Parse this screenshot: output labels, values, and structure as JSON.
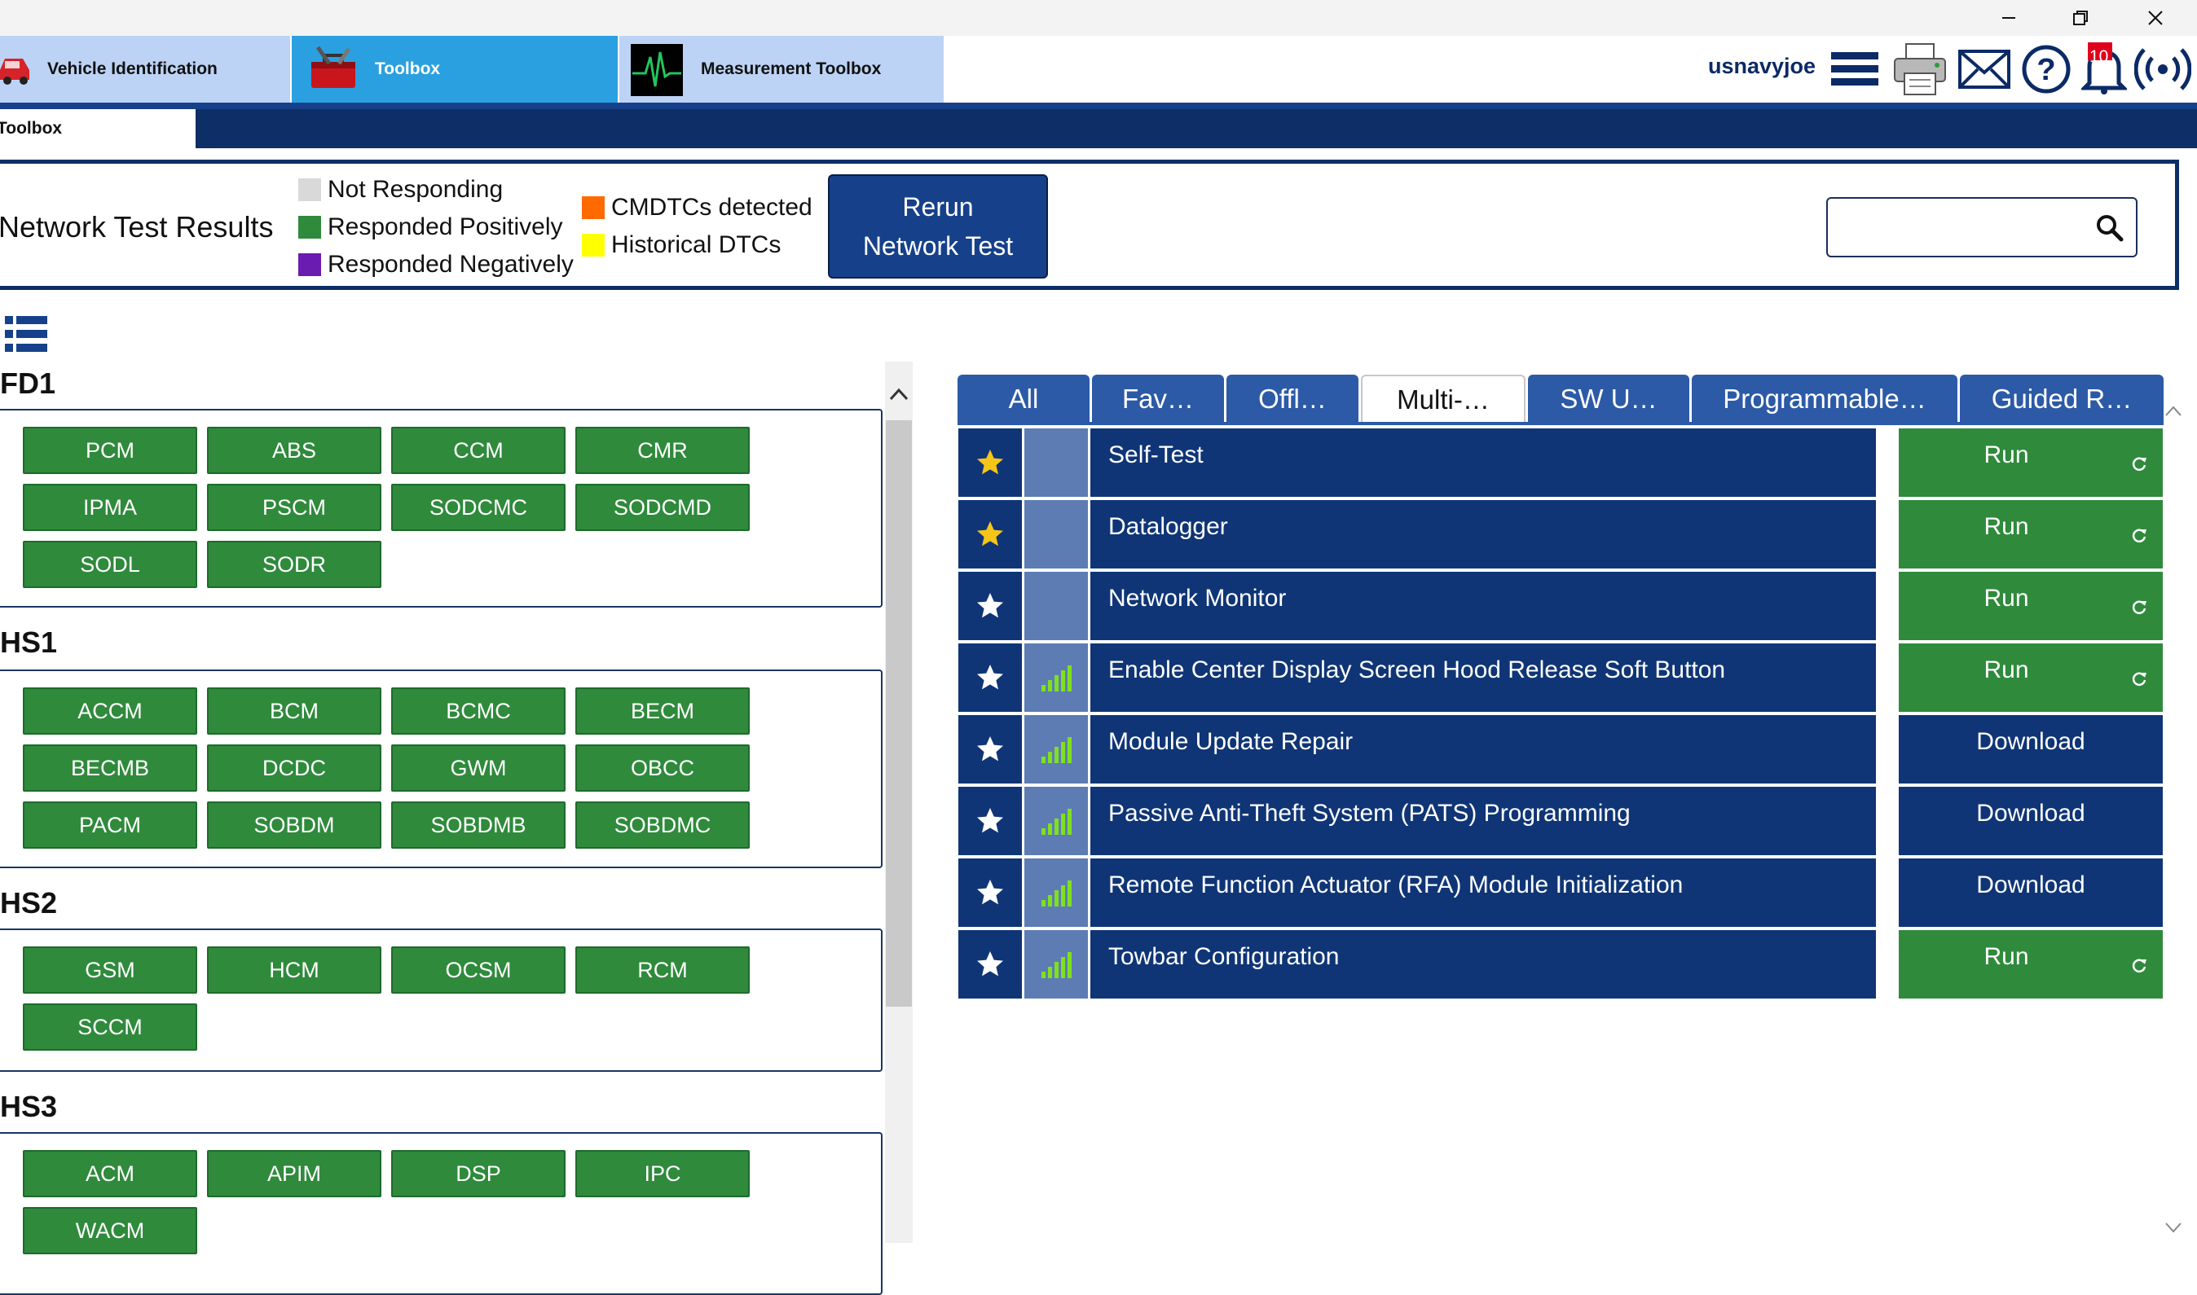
{
  "window": {
    "minimize": "—",
    "maximize": "❐",
    "close": "✕"
  },
  "app_tabs": [
    {
      "label": "Vehicle Identification",
      "icon": "car-icon"
    },
    {
      "label": "Toolbox",
      "icon": "toolbox-icon"
    },
    {
      "label": "Measurement Toolbox",
      "icon": "oscilloscope-icon"
    }
  ],
  "header": {
    "username": "usnavyjoe",
    "notification_count": "10",
    "icons": [
      "hamburger-menu-icon",
      "printer-icon",
      "mail-icon",
      "help-icon",
      "bell-icon",
      "wireless-icon"
    ]
  },
  "subnav": {
    "active_tab": "Toolbox"
  },
  "network_test": {
    "title": "Network Test Results",
    "legend": [
      {
        "label": "Not Responding",
        "color": "#d9d9d9"
      },
      {
        "label": "Responded Positively",
        "color": "#2f8a3c"
      },
      {
        "label": "Responded Negatively",
        "color": "#6a1bb0"
      },
      {
        "label": "CMDTCs detected",
        "color": "#ff6a00"
      },
      {
        "label": "Historical DTCs",
        "color": "#ffff00"
      }
    ],
    "rerun_line1": "Rerun",
    "rerun_line2": "Network Test",
    "search_value": ""
  },
  "networks": [
    {
      "name": "FD1",
      "modules": [
        "PCM",
        "ABS",
        "CCM",
        "CMR",
        "IPMA",
        "PSCM",
        "SODCMC",
        "SODCMD",
        "SODL",
        "SODR"
      ]
    },
    {
      "name": "HS1",
      "modules": [
        "ACCM",
        "BCM",
        "BCMC",
        "BECM",
        "BECMB",
        "DCDC",
        "GWM",
        "OBCC",
        "PACM",
        "SOBDM",
        "SOBDMB",
        "SOBDMC"
      ]
    },
    {
      "name": "HS2",
      "modules": [
        "GSM",
        "HCM",
        "OCSM",
        "RCM",
        "SCCM"
      ]
    },
    {
      "name": "HS3",
      "modules": [
        "ACM",
        "APIM",
        "DSP",
        "IPC",
        "WACM"
      ]
    }
  ],
  "filter_tabs": [
    {
      "label": "All",
      "active": false
    },
    {
      "label": "Fav…",
      "active": false
    },
    {
      "label": "Offl…",
      "active": false
    },
    {
      "label": "Multi-…",
      "active": true
    },
    {
      "label": "SW U…",
      "active": false
    },
    {
      "label": "Programmable…",
      "active": false
    },
    {
      "label": "Guided R…",
      "active": false
    }
  ],
  "tools": [
    {
      "name": "Self-Test",
      "favorite": true,
      "signal": false,
      "action": "Run",
      "type": "run"
    },
    {
      "name": "Datalogger",
      "favorite": true,
      "signal": false,
      "action": "Run",
      "type": "run"
    },
    {
      "name": "Network Monitor",
      "favorite": false,
      "signal": false,
      "action": "Run",
      "type": "run"
    },
    {
      "name": "Enable Center Display Screen Hood Release Soft Button",
      "favorite": false,
      "signal": true,
      "action": "Run",
      "type": "run"
    },
    {
      "name": "Module Update Repair",
      "favorite": false,
      "signal": true,
      "action": "Download",
      "type": "download"
    },
    {
      "name": "Passive Anti-Theft System (PATS) Programming",
      "favorite": false,
      "signal": true,
      "action": "Download",
      "type": "download"
    },
    {
      "name": "Remote Function Actuator (RFA) Module Initialization",
      "favorite": false,
      "signal": true,
      "action": "Download",
      "type": "download"
    },
    {
      "name": "Towbar Configuration",
      "favorite": false,
      "signal": true,
      "action": "Run",
      "type": "run"
    }
  ],
  "colors": {
    "navy": "#0f3576",
    "tab_blue": "#2c5aa6",
    "module_green": "#2f8a3c",
    "favorite_star": "#f5c518",
    "signal_green": "#7fe01f"
  }
}
